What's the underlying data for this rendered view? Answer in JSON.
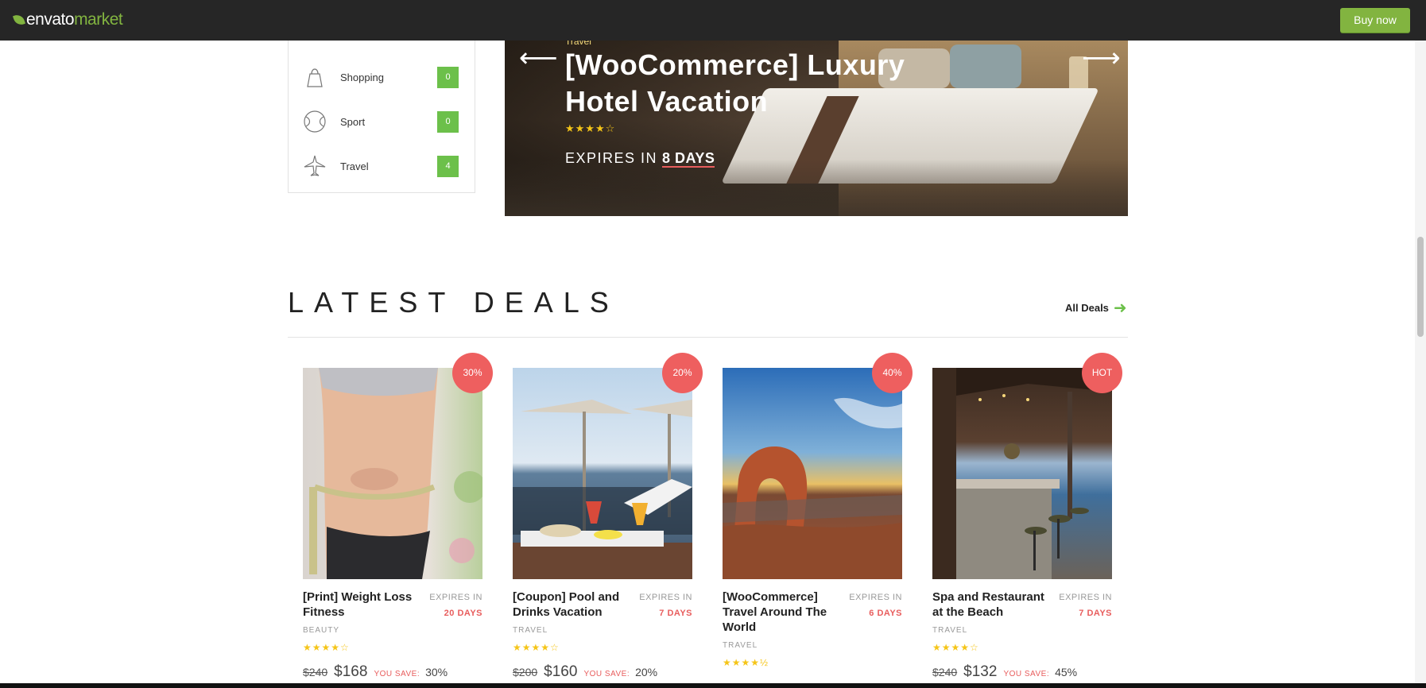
{
  "topbar": {
    "logo_part1": "envato",
    "logo_part2": "market",
    "buy_label": "Buy now"
  },
  "categories": [
    {
      "label": "Shopping",
      "count": "0",
      "icon": "shopping-bag-icon"
    },
    {
      "label": "Sport",
      "count": "0",
      "icon": "ball-icon"
    },
    {
      "label": "Travel",
      "count": "4",
      "icon": "airplane-icon"
    }
  ],
  "hero": {
    "category": "Travel",
    "title": "[WooCommerce] Luxury Hotel Vacation",
    "stars": "★★★★☆",
    "expires_label": "EXPIRES IN",
    "expires_days": "8 DAYS",
    "prev_icon": "arrow-left-icon",
    "next_icon": "arrow-right-icon"
  },
  "latest": {
    "heading": "LATEST DEALS",
    "all_deals": "All Deals"
  },
  "deals": [
    {
      "badge": "30%",
      "title": "[Print] Weight Loss Fitness",
      "expires_label": "EXPIRES IN",
      "days": "20 DAYS",
      "category": "BEAUTY",
      "stars": "★★★★☆",
      "old_price": "$240",
      "new_price": "$168",
      "save_label": "YOU SAVE:",
      "save_pct": "30%"
    },
    {
      "badge": "20%",
      "title": "[Coupon] Pool and Drinks Vacation",
      "expires_label": "EXPIRES IN",
      "days": "7 DAYS",
      "category": "TRAVEL",
      "stars": "★★★★☆",
      "old_price": "$200",
      "new_price": "$160",
      "save_label": "YOU SAVE:",
      "save_pct": "20%"
    },
    {
      "badge": "40%",
      "title": "[WooCommerce] Travel Around The World",
      "expires_label": "EXPIRES IN",
      "days": "6 DAYS",
      "category": "TRAVEL",
      "stars": "★★★★½",
      "old_price": "",
      "new_price": "",
      "save_label": "",
      "save_pct": ""
    },
    {
      "badge": "HOT",
      "title": "Spa and Restaurant at the Beach",
      "expires_label": "EXPIRES IN",
      "days": "7 DAYS",
      "category": "TRAVEL",
      "stars": "★★★★☆",
      "old_price": "$240",
      "new_price": "$132",
      "save_label": "YOU SAVE:",
      "save_pct": "45%"
    }
  ],
  "colors": {
    "brand_green": "#82b440",
    "badge_red": "#ee5f5f",
    "count_green": "#6cc04a",
    "star_yellow": "#f5c518"
  }
}
